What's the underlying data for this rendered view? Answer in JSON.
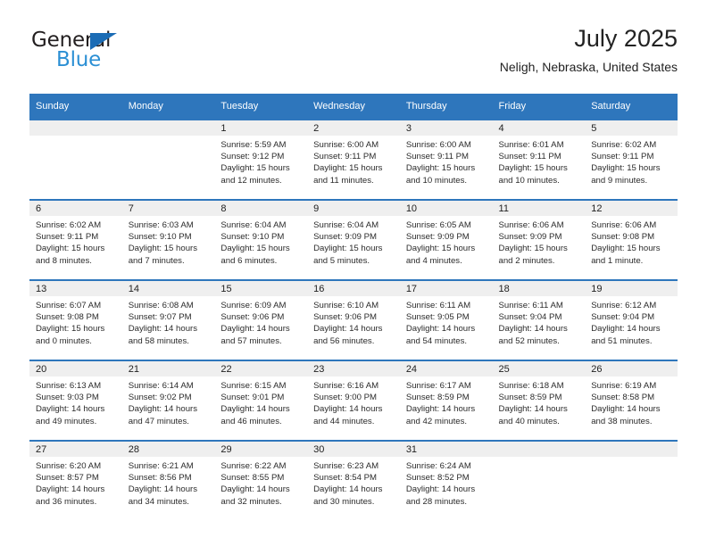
{
  "brand": {
    "name_part1": "General",
    "name_part2": "Blue",
    "triangle_color": "#1b6cb5",
    "blue_text_color": "#2b8fd4"
  },
  "header": {
    "title": "July 2025",
    "location": "Neligh, Nebraska, United States"
  },
  "theme": {
    "header_blue": "#2e76bc",
    "daynum_band": "#efefef",
    "text": "#222222"
  },
  "weekdays": [
    "Sunday",
    "Monday",
    "Tuesday",
    "Wednesday",
    "Thursday",
    "Friday",
    "Saturday"
  ],
  "labels": {
    "sunrise": "Sunrise:",
    "sunset": "Sunset:",
    "daylight": "Daylight:"
  },
  "weeks": [
    [
      {
        "day": "",
        "sunrise": "",
        "sunset": "",
        "daylight_line1": "",
        "daylight_line2": ""
      },
      {
        "day": "",
        "sunrise": "",
        "sunset": "",
        "daylight_line1": "",
        "daylight_line2": ""
      },
      {
        "day": "1",
        "sunrise": "Sunrise: 5:59 AM",
        "sunset": "Sunset: 9:12 PM",
        "daylight_line1": "Daylight: 15 hours",
        "daylight_line2": "and 12 minutes."
      },
      {
        "day": "2",
        "sunrise": "Sunrise: 6:00 AM",
        "sunset": "Sunset: 9:11 PM",
        "daylight_line1": "Daylight: 15 hours",
        "daylight_line2": "and 11 minutes."
      },
      {
        "day": "3",
        "sunrise": "Sunrise: 6:00 AM",
        "sunset": "Sunset: 9:11 PM",
        "daylight_line1": "Daylight: 15 hours",
        "daylight_line2": "and 10 minutes."
      },
      {
        "day": "4",
        "sunrise": "Sunrise: 6:01 AM",
        "sunset": "Sunset: 9:11 PM",
        "daylight_line1": "Daylight: 15 hours",
        "daylight_line2": "and 10 minutes."
      },
      {
        "day": "5",
        "sunrise": "Sunrise: 6:02 AM",
        "sunset": "Sunset: 9:11 PM",
        "daylight_line1": "Daylight: 15 hours",
        "daylight_line2": "and 9 minutes."
      }
    ],
    [
      {
        "day": "6",
        "sunrise": "Sunrise: 6:02 AM",
        "sunset": "Sunset: 9:11 PM",
        "daylight_line1": "Daylight: 15 hours",
        "daylight_line2": "and 8 minutes."
      },
      {
        "day": "7",
        "sunrise": "Sunrise: 6:03 AM",
        "sunset": "Sunset: 9:10 PM",
        "daylight_line1": "Daylight: 15 hours",
        "daylight_line2": "and 7 minutes."
      },
      {
        "day": "8",
        "sunrise": "Sunrise: 6:04 AM",
        "sunset": "Sunset: 9:10 PM",
        "daylight_line1": "Daylight: 15 hours",
        "daylight_line2": "and 6 minutes."
      },
      {
        "day": "9",
        "sunrise": "Sunrise: 6:04 AM",
        "sunset": "Sunset: 9:09 PM",
        "daylight_line1": "Daylight: 15 hours",
        "daylight_line2": "and 5 minutes."
      },
      {
        "day": "10",
        "sunrise": "Sunrise: 6:05 AM",
        "sunset": "Sunset: 9:09 PM",
        "daylight_line1": "Daylight: 15 hours",
        "daylight_line2": "and 4 minutes."
      },
      {
        "day": "11",
        "sunrise": "Sunrise: 6:06 AM",
        "sunset": "Sunset: 9:09 PM",
        "daylight_line1": "Daylight: 15 hours",
        "daylight_line2": "and 2 minutes."
      },
      {
        "day": "12",
        "sunrise": "Sunrise: 6:06 AM",
        "sunset": "Sunset: 9:08 PM",
        "daylight_line1": "Daylight: 15 hours",
        "daylight_line2": "and 1 minute."
      }
    ],
    [
      {
        "day": "13",
        "sunrise": "Sunrise: 6:07 AM",
        "sunset": "Sunset: 9:08 PM",
        "daylight_line1": "Daylight: 15 hours",
        "daylight_line2": "and 0 minutes."
      },
      {
        "day": "14",
        "sunrise": "Sunrise: 6:08 AM",
        "sunset": "Sunset: 9:07 PM",
        "daylight_line1": "Daylight: 14 hours",
        "daylight_line2": "and 58 minutes."
      },
      {
        "day": "15",
        "sunrise": "Sunrise: 6:09 AM",
        "sunset": "Sunset: 9:06 PM",
        "daylight_line1": "Daylight: 14 hours",
        "daylight_line2": "and 57 minutes."
      },
      {
        "day": "16",
        "sunrise": "Sunrise: 6:10 AM",
        "sunset": "Sunset: 9:06 PM",
        "daylight_line1": "Daylight: 14 hours",
        "daylight_line2": "and 56 minutes."
      },
      {
        "day": "17",
        "sunrise": "Sunrise: 6:11 AM",
        "sunset": "Sunset: 9:05 PM",
        "daylight_line1": "Daylight: 14 hours",
        "daylight_line2": "and 54 minutes."
      },
      {
        "day": "18",
        "sunrise": "Sunrise: 6:11 AM",
        "sunset": "Sunset: 9:04 PM",
        "daylight_line1": "Daylight: 14 hours",
        "daylight_line2": "and 52 minutes."
      },
      {
        "day": "19",
        "sunrise": "Sunrise: 6:12 AM",
        "sunset": "Sunset: 9:04 PM",
        "daylight_line1": "Daylight: 14 hours",
        "daylight_line2": "and 51 minutes."
      }
    ],
    [
      {
        "day": "20",
        "sunrise": "Sunrise: 6:13 AM",
        "sunset": "Sunset: 9:03 PM",
        "daylight_line1": "Daylight: 14 hours",
        "daylight_line2": "and 49 minutes."
      },
      {
        "day": "21",
        "sunrise": "Sunrise: 6:14 AM",
        "sunset": "Sunset: 9:02 PM",
        "daylight_line1": "Daylight: 14 hours",
        "daylight_line2": "and 47 minutes."
      },
      {
        "day": "22",
        "sunrise": "Sunrise: 6:15 AM",
        "sunset": "Sunset: 9:01 PM",
        "daylight_line1": "Daylight: 14 hours",
        "daylight_line2": "and 46 minutes."
      },
      {
        "day": "23",
        "sunrise": "Sunrise: 6:16 AM",
        "sunset": "Sunset: 9:00 PM",
        "daylight_line1": "Daylight: 14 hours",
        "daylight_line2": "and 44 minutes."
      },
      {
        "day": "24",
        "sunrise": "Sunrise: 6:17 AM",
        "sunset": "Sunset: 8:59 PM",
        "daylight_line1": "Daylight: 14 hours",
        "daylight_line2": "and 42 minutes."
      },
      {
        "day": "25",
        "sunrise": "Sunrise: 6:18 AM",
        "sunset": "Sunset: 8:59 PM",
        "daylight_line1": "Daylight: 14 hours",
        "daylight_line2": "and 40 minutes."
      },
      {
        "day": "26",
        "sunrise": "Sunrise: 6:19 AM",
        "sunset": "Sunset: 8:58 PM",
        "daylight_line1": "Daylight: 14 hours",
        "daylight_line2": "and 38 minutes."
      }
    ],
    [
      {
        "day": "27",
        "sunrise": "Sunrise: 6:20 AM",
        "sunset": "Sunset: 8:57 PM",
        "daylight_line1": "Daylight: 14 hours",
        "daylight_line2": "and 36 minutes."
      },
      {
        "day": "28",
        "sunrise": "Sunrise: 6:21 AM",
        "sunset": "Sunset: 8:56 PM",
        "daylight_line1": "Daylight: 14 hours",
        "daylight_line2": "and 34 minutes."
      },
      {
        "day": "29",
        "sunrise": "Sunrise: 6:22 AM",
        "sunset": "Sunset: 8:55 PM",
        "daylight_line1": "Daylight: 14 hours",
        "daylight_line2": "and 32 minutes."
      },
      {
        "day": "30",
        "sunrise": "Sunrise: 6:23 AM",
        "sunset": "Sunset: 8:54 PM",
        "daylight_line1": "Daylight: 14 hours",
        "daylight_line2": "and 30 minutes."
      },
      {
        "day": "31",
        "sunrise": "Sunrise: 6:24 AM",
        "sunset": "Sunset: 8:52 PM",
        "daylight_line1": "Daylight: 14 hours",
        "daylight_line2": "and 28 minutes."
      },
      {
        "day": "",
        "sunrise": "",
        "sunset": "",
        "daylight_line1": "",
        "daylight_line2": ""
      },
      {
        "day": "",
        "sunrise": "",
        "sunset": "",
        "daylight_line1": "",
        "daylight_line2": ""
      }
    ]
  ]
}
